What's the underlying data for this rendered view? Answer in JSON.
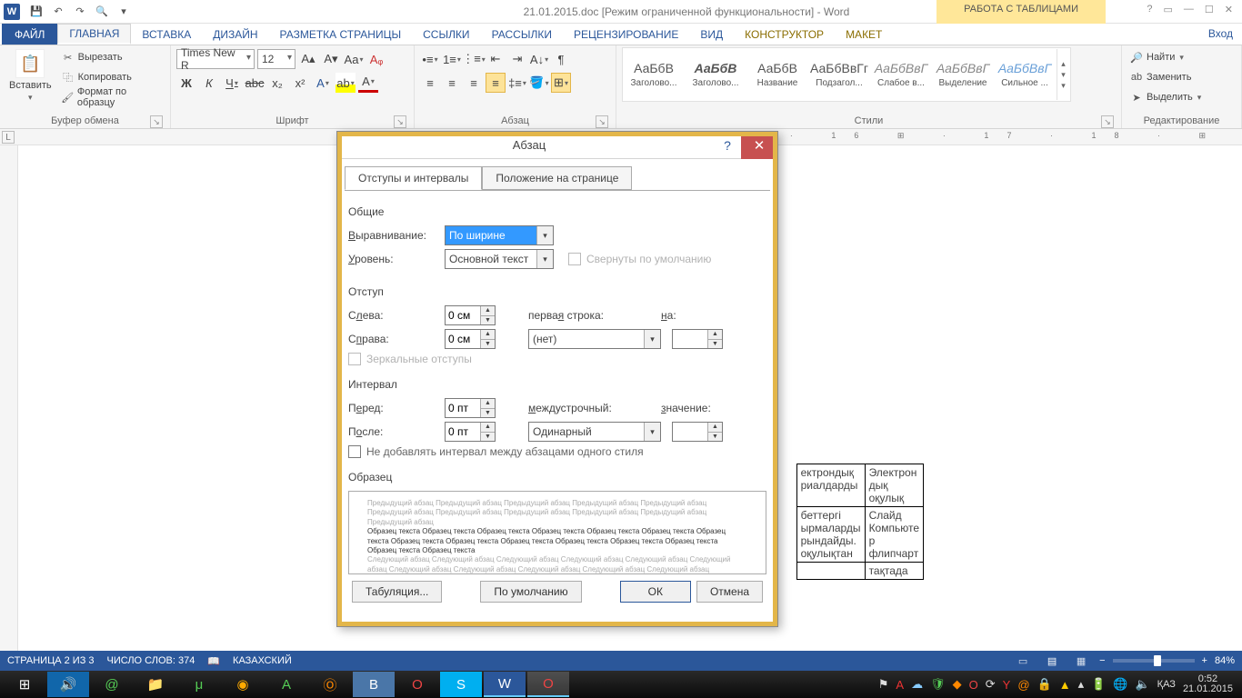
{
  "qat": {
    "doc_title": "21.01.2015.doc [Режим ограниченной функциональности] - Word"
  },
  "table_tools": "РАБОТА С ТАБЛИЦАМИ",
  "tabs": {
    "file": "ФАЙЛ",
    "home": "ГЛАВНАЯ",
    "insert": "ВСТАВКА",
    "design": "ДИЗАЙН",
    "layout": "РАЗМЕТКА СТРАНИЦЫ",
    "refs": "ССЫЛКИ",
    "mail": "РАССЫЛКИ",
    "review": "РЕЦЕНЗИРОВАНИЕ",
    "view": "ВИД",
    "constructor": "КОНСТРУКТОР",
    "tlayout": "МАКЕТ",
    "signin": "Вход"
  },
  "ribbon": {
    "clipboard": {
      "paste": "Вставить",
      "cut": "Вырезать",
      "copy": "Копировать",
      "format": "Формат по образцу",
      "label": "Буфер обмена"
    },
    "font": {
      "name": "Times New R",
      "size": "12",
      "label": "Шрифт"
    },
    "paragraph": {
      "label": "Абзац"
    },
    "styles": {
      "label": "Стили",
      "items": [
        {
          "prev": "АаБбВ",
          "name": "Заголово..."
        },
        {
          "prev": "АаБбВ",
          "name": "Заголово...",
          "italic": true,
          "bold": true
        },
        {
          "prev": "АаБбВ",
          "name": "Название"
        },
        {
          "prev": "АаБбВвГг",
          "name": "Подзагол..."
        },
        {
          "prev": "АаБбВвГ",
          "name": "Слабое в...",
          "italic": true,
          "color": "#888"
        },
        {
          "prev": "АаБбВвГ",
          "name": "Выделение",
          "italic": true,
          "color": "#888"
        },
        {
          "prev": "АаБбВвГ",
          "name": "Сильное ...",
          "italic": true,
          "color": "#6aa0d8"
        }
      ]
    },
    "editing": {
      "find": "Найти",
      "replace": "Заменить",
      "select": "Выделить",
      "label": "Редактирование"
    }
  },
  "dialog": {
    "title": "Абзац",
    "tab1": "Отступы и интервалы",
    "tab2": "Положение на странице",
    "sec_general": "Общие",
    "align_label": "Выравнивание:",
    "align_val": "По ширине",
    "level_label": "Уровень:",
    "level_val": "Основной текст",
    "collapse": "Свернуты по умолчанию",
    "sec_indent": "Отступ",
    "left": "Слева:",
    "left_v": "0 см",
    "right": "Справа:",
    "right_v": "0 см",
    "firstline": "первая строка:",
    "firstline_v": "(нет)",
    "by": "на:",
    "mirror": "Зеркальные отступы",
    "sec_spacing": "Интервал",
    "before": "Перед:",
    "before_v": "0 пт",
    "after": "После:",
    "after_v": "0 пт",
    "linespace": "междустрочный:",
    "linespace_v": "Одинарный",
    "value": "значение:",
    "nosame": "Не добавлять интервал между абзацами одного стиля",
    "sec_preview": "Образец",
    "preview_prev": "Предыдущий абзац Предыдущий абзац Предыдущий абзац Предыдущий абзац Предыдущий абзац Предыдущий абзац Предыдущий абзац Предыдущий абзац Предыдущий абзац Предыдущий абзац Предыдущий абзац",
    "preview_sample": "Образец текста Образец текста Образец текста Образец текста Образец текста Образец текста Образец текста Образец текста Образец текста Образец текста Образец текста Образец текста Образец текста Образец текста Образец текста",
    "preview_next": "Следующий абзац Следующий абзац Следующий абзац Следующий абзац Следующий абзац Следующий абзац Следующий абзац Следующий абзац Следующий абзац Следующий абзац Следующий абзац Следующий абзац",
    "btn_tabs": "Табуляция...",
    "btn_default": "По умолчанию",
    "btn_ok": "ОК",
    "btn_cancel": "Отмена"
  },
  "doc_table": {
    "c1a": "ектрондық",
    "c1b": "риалдарды",
    "c2a": "Электрон",
    "c2b": "дық",
    "c2c": "оқулық",
    "c3a": "беттергі",
    "c3b": "ырмаларды",
    "c3c": "рындайды.",
    "c3d": "оқулықтан",
    "c4a": "Слайд",
    "c4b": "Компьюте",
    "c4c": "р",
    "c4d": "флипчарт",
    "c5": "тақтада"
  },
  "status": {
    "page": "СТРАНИЦА 2 ИЗ 3",
    "words": "ЧИСЛО СЛОВ: 374",
    "lang": "КАЗАХСКИЙ",
    "zoom": "84%"
  },
  "taskbar": {
    "lang": "ҚАЗ",
    "time": "0:52",
    "date": "21.01.2015"
  }
}
